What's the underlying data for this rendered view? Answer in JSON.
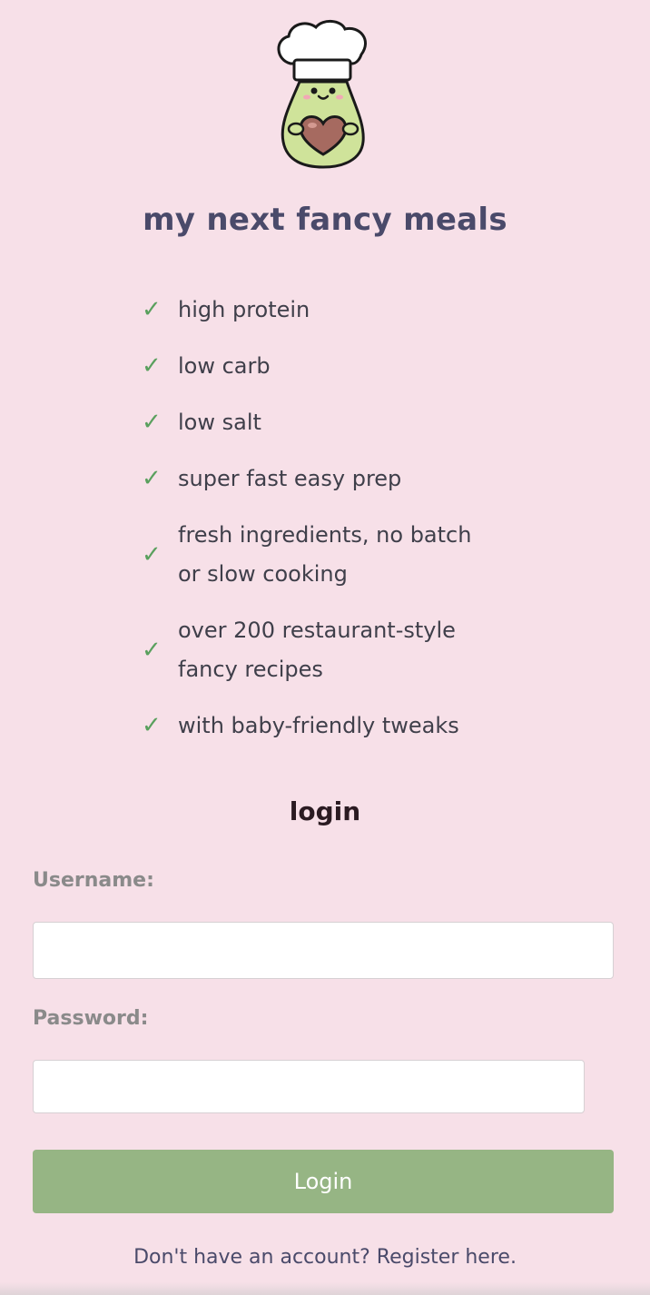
{
  "app": {
    "title": "my next fancy meals",
    "mascot_icon": "chef-avocado-icon"
  },
  "features": [
    {
      "icon": "check-icon",
      "text": "high protein"
    },
    {
      "icon": "check-icon",
      "text": "low carb"
    },
    {
      "icon": "check-icon",
      "text": "low salt"
    },
    {
      "icon": "check-icon",
      "text": "super fast easy prep"
    },
    {
      "icon": "check-icon",
      "text": "fresh ingredients, no batch or slow cooking"
    },
    {
      "icon": "check-icon",
      "text": "over 200 restaurant-style fancy recipes"
    },
    {
      "icon": "check-icon",
      "text": "with baby-friendly tweaks"
    }
  ],
  "login": {
    "heading": "login",
    "username_label": "Username:",
    "username_value": "",
    "password_label": "Password:",
    "password_value": "",
    "button_label": "Login"
  },
  "register": {
    "prompt": "Don't have an account?",
    "link_label": "Register here."
  },
  "colors": {
    "background": "#f7e0e8",
    "title": "#4a4a6a",
    "check": "#5aa05e",
    "button": "#96b584",
    "label": "#8a8a8a"
  }
}
